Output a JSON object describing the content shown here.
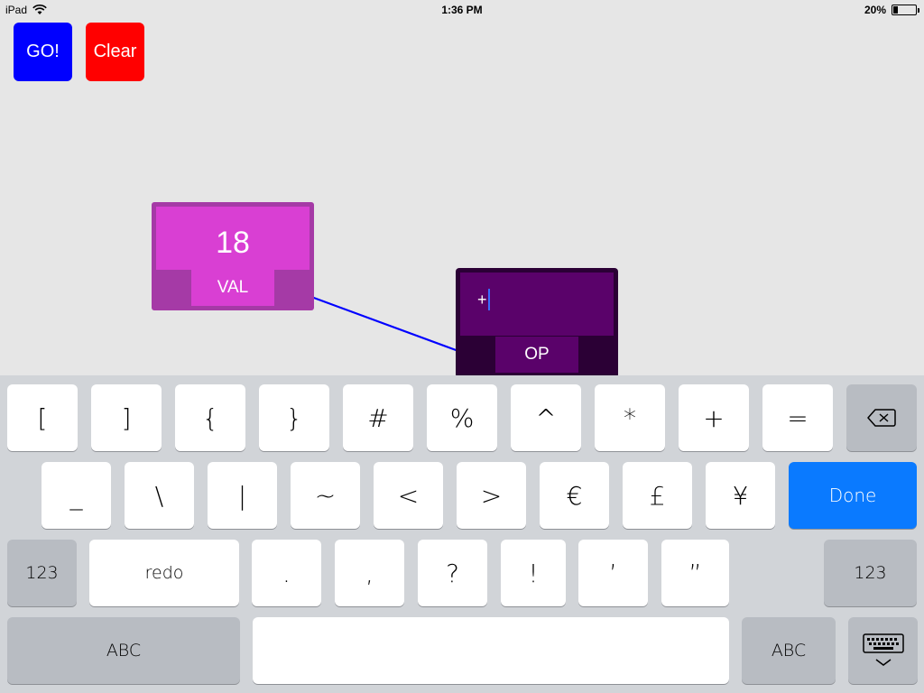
{
  "status_bar": {
    "device": "iPad",
    "time": "1:36 PM",
    "battery_text": "20%",
    "battery_level": 0.2
  },
  "toolbar": {
    "go_label": "GO!",
    "clear_label": "Clear"
  },
  "canvas": {
    "val_node": {
      "value": "18",
      "type_label": "VAL"
    },
    "op_node": {
      "value": "+",
      "type_label": "OP"
    }
  },
  "keyboard": {
    "row1": [
      "[",
      "]",
      "{",
      "}",
      "#",
      "%",
      "^",
      "*",
      "+",
      "="
    ],
    "row2": [
      "_",
      "\\",
      "|",
      "~",
      "<",
      ">",
      "€",
      "£",
      "¥"
    ],
    "done_label": "Done",
    "row3": [
      ".",
      ",",
      "?",
      "!",
      "’",
      "”"
    ],
    "numbers_label": "123",
    "redo_label": "redo",
    "abc_label": "ABC"
  }
}
